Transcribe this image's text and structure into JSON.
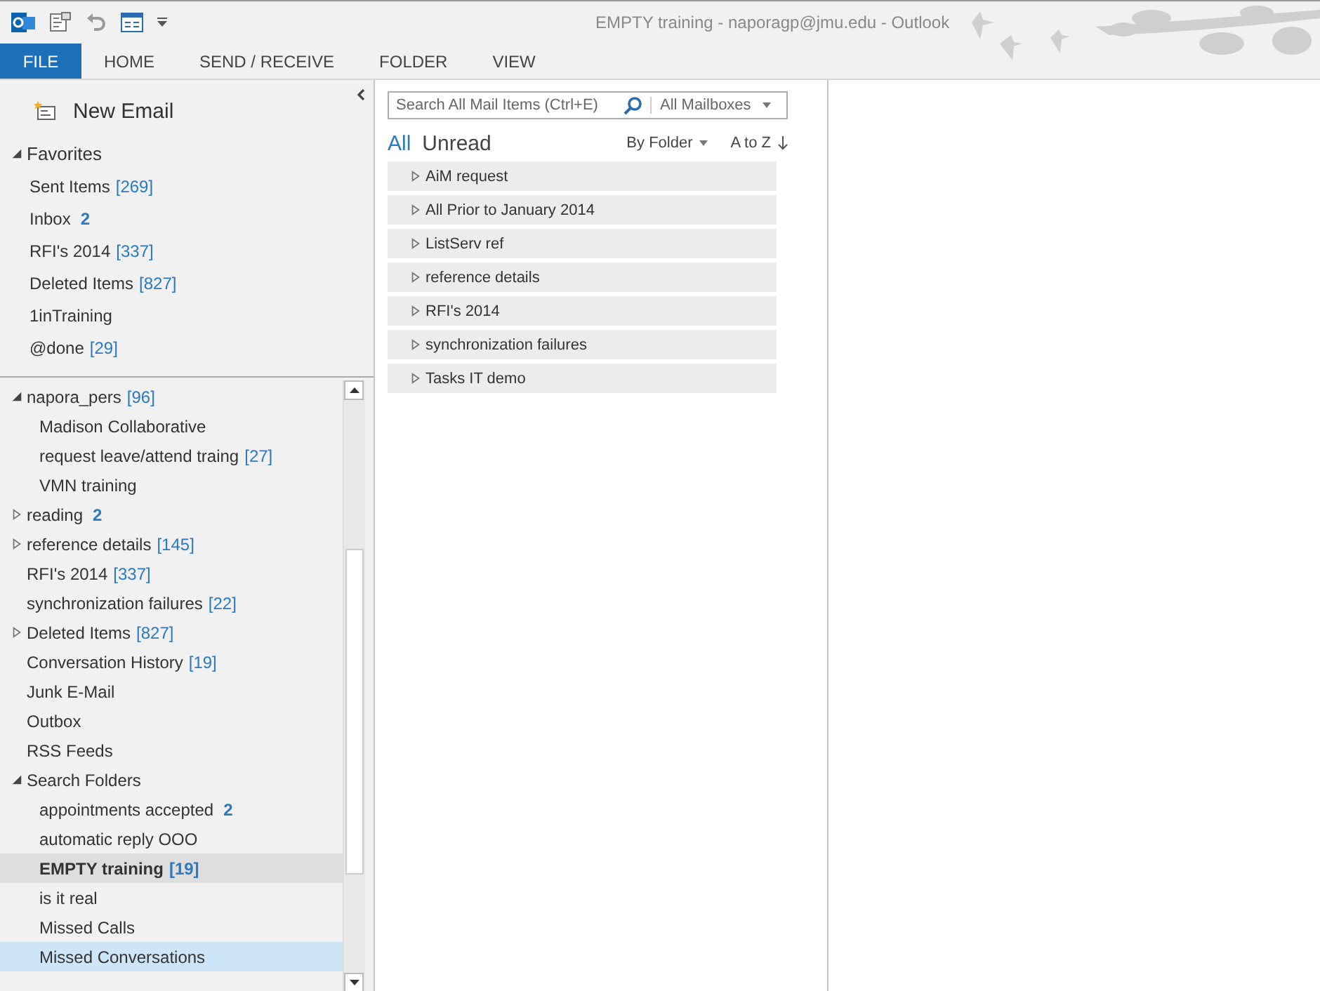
{
  "window": {
    "title": "EMPTY training - naporagp@jmu.edu - Outlook"
  },
  "ribbon_tabs": [
    {
      "label": "FILE",
      "selected": true
    },
    {
      "label": "HOME",
      "selected": false
    },
    {
      "label": "SEND / RECEIVE",
      "selected": false
    },
    {
      "label": "FOLDER",
      "selected": false
    },
    {
      "label": "VIEW",
      "selected": false
    }
  ],
  "new_email": {
    "label": "New Email"
  },
  "favorites": {
    "label": "Favorites",
    "expanded": true,
    "items": [
      {
        "name": "Sent Items",
        "count": "[269]"
      },
      {
        "name": "Inbox",
        "unread": "2"
      },
      {
        "name": "RFI's 2014",
        "count": "[337]"
      },
      {
        "name": "Deleted Items",
        "count": "[827]"
      },
      {
        "name": "1inTraining"
      },
      {
        "name": "@done",
        "count": "[29]"
      }
    ]
  },
  "folders": [
    {
      "name": "napora_pers",
      "count": "[96]",
      "expanded": true,
      "selected": false,
      "hovered": false,
      "children": [
        {
          "name": "Madison Collaborative",
          "selected": false,
          "hovered": false
        },
        {
          "name": "request leave/attend traing",
          "count": "[27]",
          "selected": false,
          "hovered": false
        },
        {
          "name": "VMN training",
          "selected": false,
          "hovered": false
        }
      ]
    },
    {
      "name": "reading",
      "unread": "2",
      "expanded": false,
      "selected": false,
      "hovered": false
    },
    {
      "name": "reference details",
      "count": "[145]",
      "expanded": false,
      "selected": false,
      "hovered": false
    },
    {
      "name": "RFI's 2014",
      "count": "[337]",
      "selected": false,
      "hovered": false
    },
    {
      "name": "synchronization failures",
      "count": "[22]",
      "selected": false,
      "hovered": false
    },
    {
      "name": "Deleted Items",
      "count": "[827]",
      "expanded": false,
      "selected": false,
      "hovered": false
    },
    {
      "name": "Conversation History",
      "count": "[19]",
      "selected": false,
      "hovered": false
    },
    {
      "name": "Junk E-Mail",
      "selected": false,
      "hovered": false
    },
    {
      "name": "Outbox",
      "selected": false,
      "hovered": false
    },
    {
      "name": "RSS Feeds",
      "selected": false,
      "hovered": false
    },
    {
      "name": "Search Folders",
      "expanded": true,
      "selected": false,
      "hovered": false,
      "children": [
        {
          "name": "appointments accepted",
          "unread": "2",
          "selected": false,
          "hovered": false
        },
        {
          "name": "automatic reply OOO",
          "selected": false,
          "hovered": false
        },
        {
          "name": "EMPTY training",
          "count": "[19]",
          "selected": true,
          "hovered": false
        },
        {
          "name": "is it real",
          "selected": false,
          "hovered": false
        },
        {
          "name": "Missed Calls",
          "selected": false,
          "hovered": false
        },
        {
          "name": "Missed Conversations",
          "selected": false,
          "hovered": true
        }
      ]
    }
  ],
  "search": {
    "placeholder": "Search All Mail Items (Ctrl+E)",
    "scope": "All Mailboxes"
  },
  "filters": [
    {
      "label": "All",
      "selected": true
    },
    {
      "label": "Unread",
      "selected": false
    }
  ],
  "arrange": {
    "group_by": "By Folder",
    "sort": "A to Z"
  },
  "groups": [
    {
      "label": "AiM request",
      "expanded": false
    },
    {
      "label": "All Prior to January 2014",
      "expanded": false
    },
    {
      "label": "ListServ ref",
      "expanded": false
    },
    {
      "label": "reference details",
      "expanded": false
    },
    {
      "label": "RFI's 2014",
      "expanded": false
    },
    {
      "label": "synchronization failures",
      "expanded": false
    },
    {
      "label": "Tasks IT demo",
      "expanded": false
    }
  ]
}
